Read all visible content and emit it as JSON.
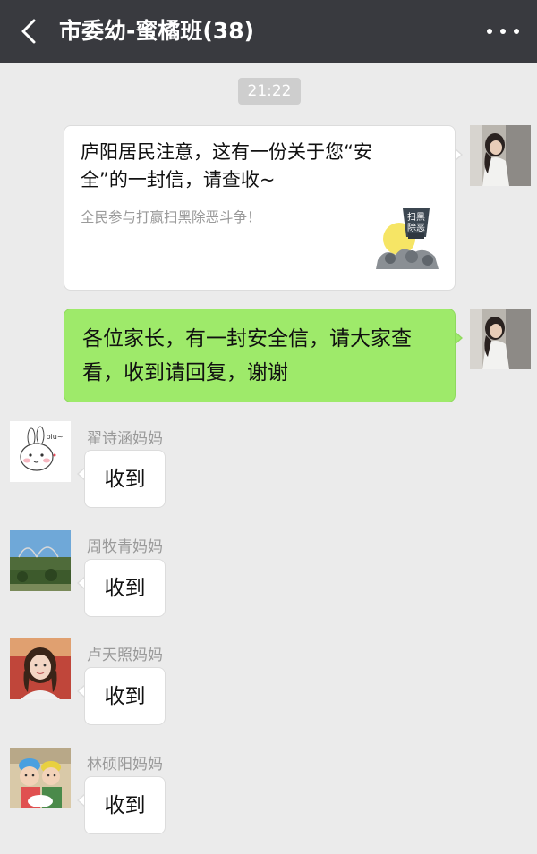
{
  "header": {
    "title": "市委幼-蜜橘班(38)",
    "back_icon": "chevron-left-icon",
    "more_icon": "more-dots-icon"
  },
  "timestamp": "21:22",
  "messages": {
    "link_card": {
      "title": "庐阳居民注意，这有一份关于您“安全”的一封信，请查收~",
      "description": "全民参与打赢扫黑除恶斗争！",
      "thumb_text": [
        "扫黑",
        "除恶"
      ]
    },
    "notice": {
      "text": "各位家长，有一封安全信，请大家查看，收到请回复，谢谢"
    },
    "replies": [
      {
        "sender": "翟诗涵妈妈",
        "text": "收到",
        "avatar_caption": "biu~"
      },
      {
        "sender": "周牧青妈妈",
        "text": "收到"
      },
      {
        "sender": "卢天照妈妈",
        "text": "收到"
      },
      {
        "sender": "林硕阳妈妈",
        "text": "收到"
      }
    ]
  },
  "colors": {
    "title_bar": "#393a3f",
    "chat_background": "#ebebeb",
    "sent_bubble": "#9eea6a",
    "received_bubble": "#ffffff"
  }
}
